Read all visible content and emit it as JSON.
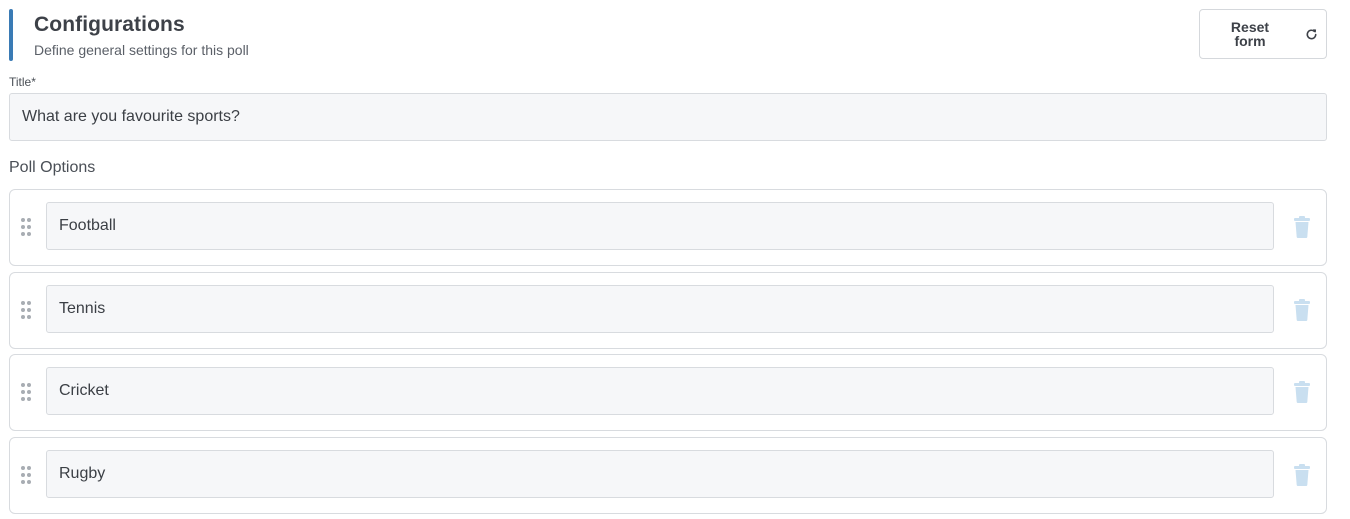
{
  "header": {
    "title": "Configurations",
    "subtitle": "Define general settings for this poll",
    "accent_color": "#3a7bb5"
  },
  "reset_button": {
    "label": "Reset\nform",
    "icon": "refresh-icon"
  },
  "title_field": {
    "label": "Title*",
    "value": "What are you favourite sports?"
  },
  "poll_options": {
    "label": "Poll Options",
    "items": [
      {
        "value": "Football",
        "drag_icon": "drag-handle-icon",
        "delete_icon": "trash-icon"
      },
      {
        "value": "Tennis",
        "drag_icon": "drag-handle-icon",
        "delete_icon": "trash-icon"
      },
      {
        "value": "Cricket",
        "drag_icon": "drag-handle-icon",
        "delete_icon": "trash-icon"
      },
      {
        "value": "Rugby",
        "drag_icon": "drag-handle-icon",
        "delete_icon": "trash-icon"
      }
    ]
  },
  "colors": {
    "delete_icon": "#c9dff0",
    "drag_handle": "#a8adb3",
    "input_background": "#f6f7f9"
  }
}
